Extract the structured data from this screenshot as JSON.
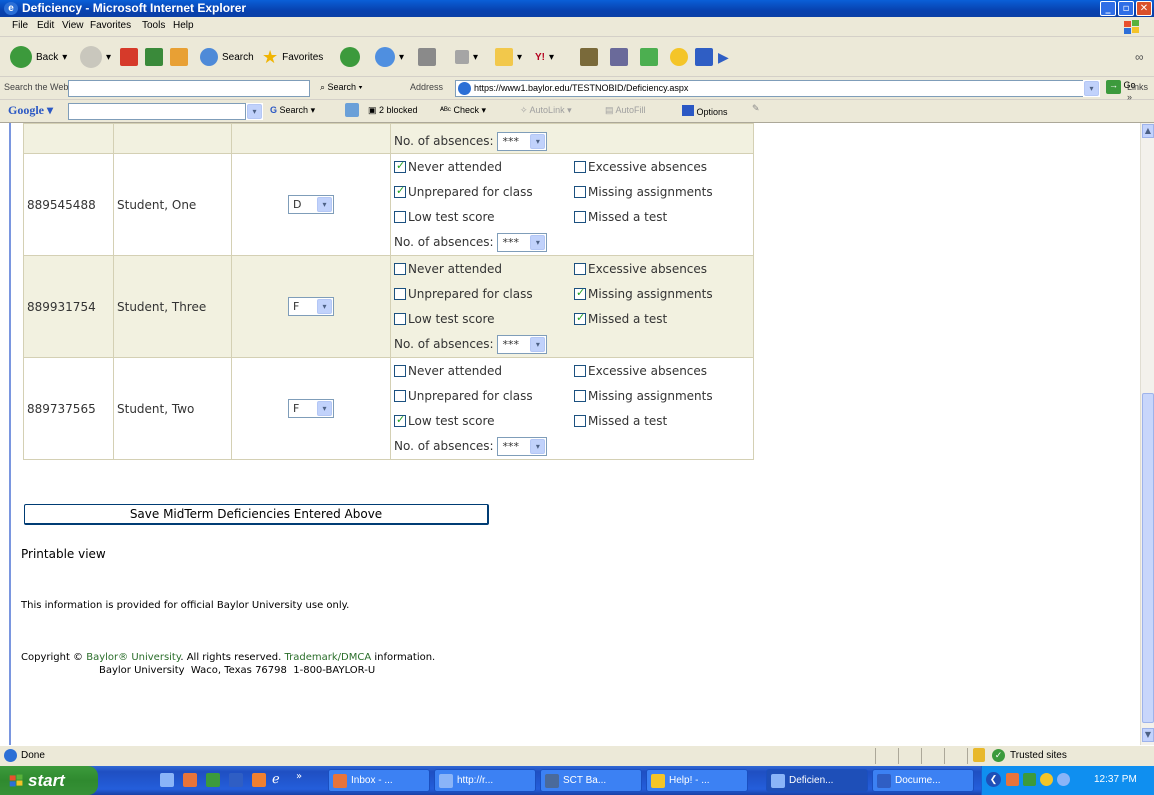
{
  "window": {
    "title": "Deficiency - Microsoft Internet Explorer"
  },
  "menu": [
    "File",
    "Edit",
    "View",
    "Favorites",
    "Tools",
    "Help"
  ],
  "toolbar": {
    "back": "Back",
    "search": "Search",
    "favorites": "Favorites"
  },
  "addressbar": {
    "search_web_label": "Search the Web",
    "search_button": "Search",
    "address_label": "Address",
    "url": "https://www1.baylor.edu/TESTNOBID/Deficiency.aspx",
    "go": "Go",
    "links": "Links"
  },
  "googlebar": {
    "brand": "Google",
    "search": "Search",
    "blocked": "2 blocked",
    "check": "Check",
    "autolink": "AutoLink",
    "autofill": "AutoFill",
    "options": "Options"
  },
  "table": {
    "absences_label": "No. of absences:",
    "absences_value": "***",
    "options": {
      "never": "Never attended",
      "excessive": "Excessive absences",
      "unprepared": "Unprepared for class",
      "missing": "Missing assignments",
      "low": "Low test score",
      "missed": "Missed a test"
    },
    "rows": [
      {
        "id": "889545488",
        "name": "Student, One",
        "grade": "D",
        "never": true,
        "excessive": false,
        "unprepared": true,
        "missing": false,
        "low": false,
        "missed": false
      },
      {
        "id": "889931754",
        "name": "Student, Three",
        "grade": "F",
        "never": false,
        "excessive": false,
        "unprepared": false,
        "missing": true,
        "low": false,
        "missed": true
      },
      {
        "id": "889737565",
        "name": "Student, Two",
        "grade": "F",
        "never": false,
        "excessive": false,
        "unprepared": false,
        "missing": false,
        "low": true,
        "missed": false
      }
    ]
  },
  "save_button": "Save MidTerm Deficiencies Entered Above",
  "printable_view": "Printable view",
  "notice": "This information is provided for official Baylor University use only.",
  "footer": {
    "copyright_pre": "Copyright ©",
    "baylor_link": "Baylor® University",
    "rights": ". All rights reserved.",
    "trademark_link": "Trademark/DMCA",
    "info": "information.",
    "address": "Baylor University  Waco, Texas 76798  1-800-BAYLOR-U"
  },
  "status": {
    "text": "Done",
    "zone": "Trusted sites"
  },
  "taskbar": {
    "start": "start",
    "tasks": [
      "Inbox - ...",
      "http://r...",
      "SCT Ba...",
      "Help! - ...",
      "Deficien...",
      "Docume..."
    ],
    "clock": "12:37 PM"
  }
}
